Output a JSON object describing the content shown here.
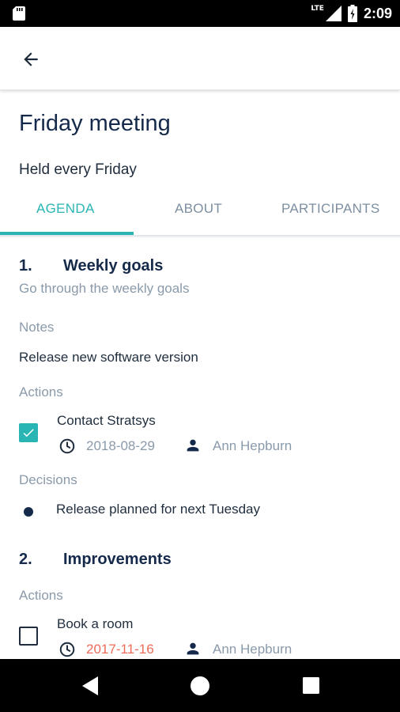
{
  "status_bar": {
    "network": "LTE",
    "time": "2:09"
  },
  "header": {
    "title": "Friday meeting",
    "subtitle": "Held every Friday"
  },
  "tabs": [
    {
      "label": "AGENDA",
      "active": true
    },
    {
      "label": "ABOUT",
      "active": false
    },
    {
      "label": "PARTICIPANTS",
      "active": false
    }
  ],
  "agenda": [
    {
      "number": "1.",
      "title": "Weekly goals",
      "description": "Go through the weekly goals",
      "notes_label": "Notes",
      "notes": "Release new software version",
      "actions_label": "Actions",
      "actions": [
        {
          "title": "Contact Stratsys",
          "date": "2018-08-29",
          "assignee": "Ann Hepburn",
          "done": true,
          "overdue": false
        }
      ],
      "decisions_label": "Decisions",
      "decisions": [
        "Release planned for next Tuesday"
      ]
    },
    {
      "number": "2.",
      "title": "Improvements",
      "actions_label": "Actions",
      "actions": [
        {
          "title": "Book a room",
          "date": "2017-11-16",
          "assignee": "Ann Hepburn",
          "done": false,
          "overdue": true
        }
      ]
    }
  ],
  "colors": {
    "accent": "#2ab5b5",
    "title": "#15294a",
    "muted": "#8a9aab",
    "overdue": "#ef6b5b"
  },
  "icons": {
    "back": "arrow-left-icon",
    "date": "clock-icon",
    "assignee": "person-icon",
    "nav_back": "triangle-back-icon",
    "nav_home": "circle-home-icon",
    "nav_recents": "square-recents-icon"
  }
}
